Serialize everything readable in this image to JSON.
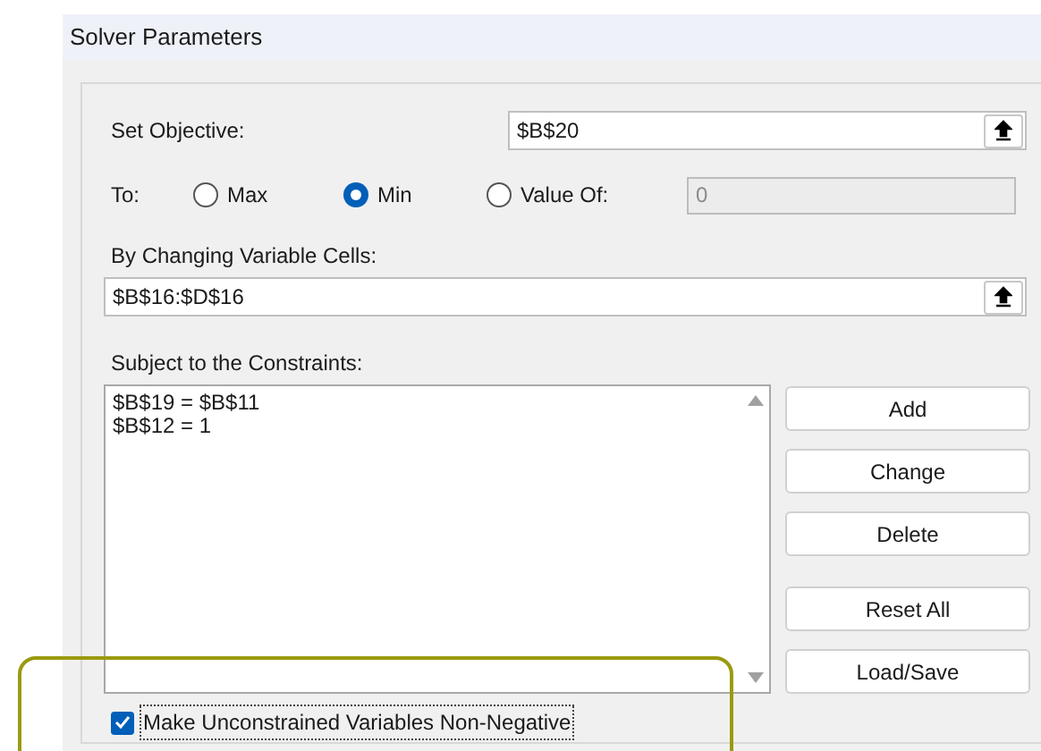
{
  "window": {
    "title": "Solver Parameters"
  },
  "objective": {
    "label": "Set Objective:",
    "value": "$B$20"
  },
  "to": {
    "label": "To:",
    "options": [
      {
        "label": "Max",
        "selected": false
      },
      {
        "label": "Min",
        "selected": true
      },
      {
        "label": "Value Of:",
        "selected": false
      }
    ],
    "value_field": {
      "value": "0",
      "disabled": true
    }
  },
  "changing_cells": {
    "label": "By Changing Variable Cells:",
    "value": "$B$16:$D$16"
  },
  "constraints": {
    "label": "Subject to the Constraints:",
    "items": [
      "$B$19 = $B$11",
      "$B$12 = 1"
    ]
  },
  "buttons": [
    "Add",
    "Change",
    "Delete",
    "Reset All",
    "Load/Save"
  ],
  "non_negative": {
    "label": "Make Unconstrained Variables Non-Negative",
    "checked": true
  }
}
